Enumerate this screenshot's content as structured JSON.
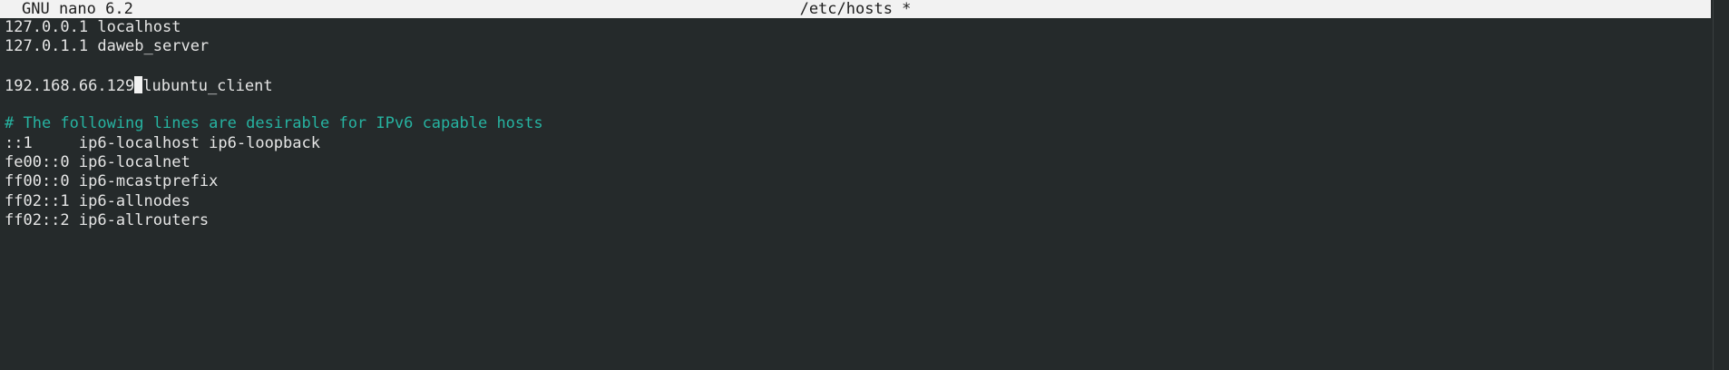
{
  "titlebar": {
    "app": "GNU nano 6.2",
    "filename": "/etc/hosts *"
  },
  "editor": {
    "lines": [
      "127.0.0.1 localhost",
      "127.0.1.1 daweb_server",
      "",
      "",
      "",
      "# The following lines are desirable for IPv6 capable hosts",
      "::1     ip6-localhost ip6-loopback",
      "fe00::0 ip6-localnet",
      "ff00::0 ip6-mcastprefix",
      "ff02::1 ip6-allnodes",
      "ff02::2 ip6-allrouters"
    ],
    "cursor_line": {
      "before_cursor": "192.168.66.129",
      "after_cursor": "lubuntu_client"
    }
  },
  "colors": {
    "background": "#252a2b",
    "text": "#e6e6e6",
    "titlebar_bg": "#f2f2f2",
    "comment": "#26b3a1"
  }
}
